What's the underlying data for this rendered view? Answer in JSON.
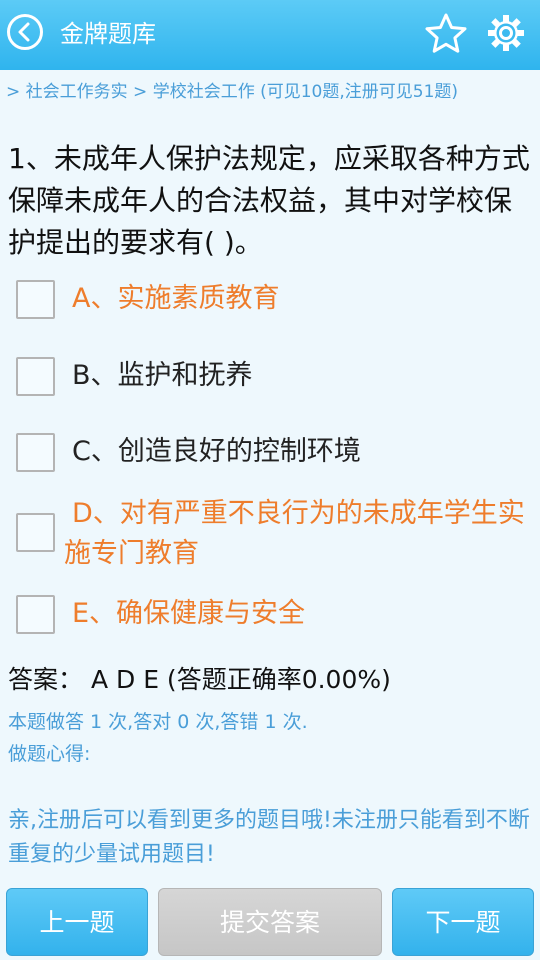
{
  "header": {
    "title": "金牌题库",
    "back_icon": "back-arrow-icon",
    "favorite_icon": "star-icon",
    "settings_icon": "gear-icon"
  },
  "breadcrumb": "> 社会工作务实 > 学校社会工作 (可见10题,注册可见51题)",
  "question": {
    "text": "1、未成年人保护法规定，应采取各种方式保障未成年人的合法权益，其中对学校保护提出的要求有( )。",
    "options": [
      {
        "label": "A、实施素质教育",
        "correct": true,
        "checked": false
      },
      {
        "label": "B、监护和抚养",
        "correct": false,
        "checked": false
      },
      {
        "label": "C、创造良好的控制环境",
        "correct": false,
        "checked": false
      },
      {
        "label": "D、对有严重不良行为的未成年学生实施专门教育",
        "correct": true,
        "checked": false
      },
      {
        "label": "E、确保健康与安全",
        "correct": true,
        "checked": false
      }
    ]
  },
  "answer": {
    "text": "答案： A D E (答题正确率0.00%)"
  },
  "stats": {
    "text": "本题做答 1 次,答对 0 次,答错 1 次.",
    "notes_label": "做题心得:"
  },
  "register_note": "亲,注册后可以看到更多的题目哦!未注册只能看到不断重复的少量试用题目!",
  "buttons": {
    "prev": "上一题",
    "submit": "提交答案",
    "next": "下一题"
  },
  "colors": {
    "header": "#2fb4ee",
    "correct_option": "#ee7d2c",
    "info_text": "#4a9ed8",
    "background": "#eef8fd"
  }
}
